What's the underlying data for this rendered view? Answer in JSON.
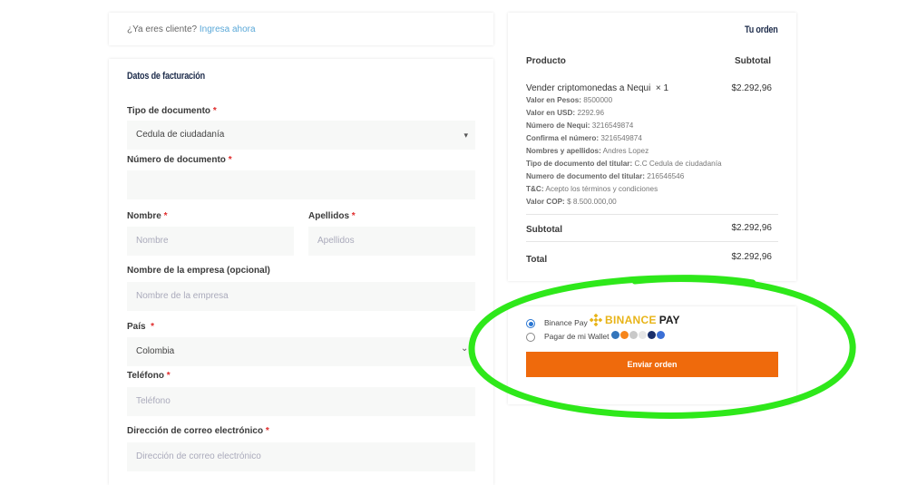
{
  "login": {
    "prompt": "¿Ya eres cliente?",
    "link": "Ingresa ahora"
  },
  "billing": {
    "title": "Datos de facturación",
    "fields": {
      "doc_type": {
        "label": "Tipo de documento",
        "value": "Cedula de ciudadanía"
      },
      "doc_number": {
        "label": "Número de documento",
        "placeholder": ""
      },
      "first_name": {
        "label": "Nombre",
        "placeholder": "Nombre"
      },
      "last_name": {
        "label": "Apellidos",
        "placeholder": "Apellidos"
      },
      "company": {
        "label": "Nombre de la empresa (opcional)",
        "placeholder": "Nombre de la empresa"
      },
      "country": {
        "label": "País",
        "value": "Colombia"
      },
      "phone": {
        "label": "Teléfono",
        "placeholder": "Teléfono"
      },
      "email": {
        "label": "Dirección de correo electrónico",
        "placeholder": "Dirección de correo electrónico"
      }
    },
    "required_mark": "*"
  },
  "order": {
    "title": "Tu orden",
    "col_product": "Producto",
    "col_subtotal": "Subtotal",
    "item": {
      "name": "Vender criptomonedas a Nequi",
      "qty": "× 1",
      "price": "$2.292,96",
      "meta": [
        {
          "label": "Valor en Pesos:",
          "value": "8500000"
        },
        {
          "label": "Valor en USD:",
          "value": "2292.96"
        },
        {
          "label": "Número de Nequi:",
          "value": "3216549874"
        },
        {
          "label": "Confirma el número:",
          "value": "3216549874"
        },
        {
          "label": "Nombres y apellidos:",
          "value": "Andres Lopez"
        },
        {
          "label": "Tipo de documento del titular:",
          "value": "C.C Cedula de ciudadanía"
        },
        {
          "label": "Numero de documento del titular:",
          "value": "216546546"
        },
        {
          "label": "T&C:",
          "value": "Acepto los términos y condiciones"
        },
        {
          "label": "Valor COP:",
          "value": "$ 8.500.000,00"
        }
      ]
    },
    "subtotal_label": "Subtotal",
    "subtotal_value": "$2.292,96",
    "total_label": "Total",
    "total_value": "$2.292,96"
  },
  "payment": {
    "option1": "Binance Pay",
    "binance_word": "BINANCE",
    "binance_pay": "PAY",
    "option2": "Pagar de mi Wallet",
    "selected": "option1",
    "submit": "Enviar orden"
  },
  "colors": {
    "accent": "#ef6a0c",
    "binance": "#e8b418",
    "link": "#5aa8d8",
    "highlight": "#2ee81a"
  }
}
